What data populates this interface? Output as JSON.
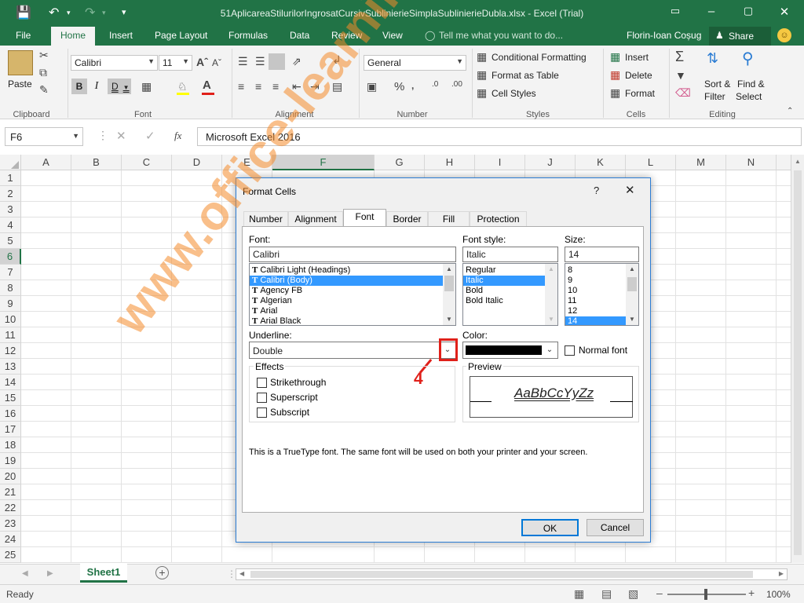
{
  "title": "51AplicareaStilurilorIngrosatCursivSublinierieSimplaSublinierieDubla.xlsx - Excel (Trial)",
  "user": "Florin-Ioan Coșug",
  "share": "Share",
  "tell_me": "Tell me what you want to do...",
  "tabs": [
    "File",
    "Home",
    "Insert",
    "Page Layout",
    "Formulas",
    "Data",
    "Review",
    "View"
  ],
  "ribbon": {
    "paste": "Paste",
    "font_name": "Calibri",
    "font_size": "11",
    "number_format": "General",
    "conditional_formatting": "Conditional Formatting",
    "format_as_table": "Format as Table",
    "cell_styles": "Cell Styles",
    "insert": "Insert",
    "delete": "Delete",
    "format": "Format",
    "sort_filter_1": "Sort &",
    "sort_filter_2": "Filter",
    "find_select_1": "Find &",
    "find_select_2": "Select",
    "groups": [
      "Clipboard",
      "Font",
      "Alignment",
      "Number",
      "Styles",
      "Cells",
      "Editing"
    ]
  },
  "formula_bar": {
    "name_box": "F6",
    "fx": "fx",
    "content": "Microsoft Excel 2016"
  },
  "columns": [
    "A",
    "B",
    "C",
    "D",
    "E",
    "F",
    "G",
    "H",
    "I",
    "J",
    "K",
    "L",
    "M",
    "N"
  ],
  "rows": [
    "1",
    "2",
    "3",
    "4",
    "5",
    "6",
    "7",
    "8",
    "9",
    "10",
    "11",
    "12",
    "13",
    "14",
    "15",
    "16",
    "17",
    "18",
    "19",
    "20",
    "21",
    "22",
    "23",
    "24",
    "25"
  ],
  "sheet_tab": "Sheet1",
  "status": {
    "ready": "Ready",
    "zoom": "100%"
  },
  "dialog": {
    "title": "Format Cells",
    "help": "?",
    "tabs": [
      "Number",
      "Alignment",
      "Font",
      "Border",
      "Fill",
      "Protection"
    ],
    "font_label": "Font:",
    "font_value": "Calibri",
    "font_list": [
      "Calibri Light (Headings)",
      "Calibri (Body)",
      "Agency FB",
      "Algerian",
      "Arial",
      "Arial Black"
    ],
    "style_label": "Font style:",
    "style_value": "Italic",
    "style_list": [
      "Regular",
      "Italic",
      "Bold",
      "Bold Italic"
    ],
    "size_label": "Size:",
    "size_value": "14",
    "size_list": [
      "8",
      "9",
      "10",
      "11",
      "12",
      "14"
    ],
    "underline_label": "Underline:",
    "underline_value": "Double",
    "color_label": "Color:",
    "color_value": "#000000",
    "normal_font": "Normal font",
    "effects_label": "Effects",
    "effects": [
      "Strikethrough",
      "Superscript",
      "Subscript"
    ],
    "preview_label": "Preview",
    "preview_text": "AaBbCcYyZz",
    "info": "This is a TrueType font.  The same font will be used on both your printer and your screen.",
    "ok": "OK",
    "cancel": "Cancel"
  },
  "annotation": "4",
  "watermark": "www.office-learning.ro",
  "colors": {
    "excel_green": "#217346",
    "annotation_red": "#e0201a",
    "selection_blue": "#3399ff",
    "watermark_orange": "#f48a2a"
  }
}
